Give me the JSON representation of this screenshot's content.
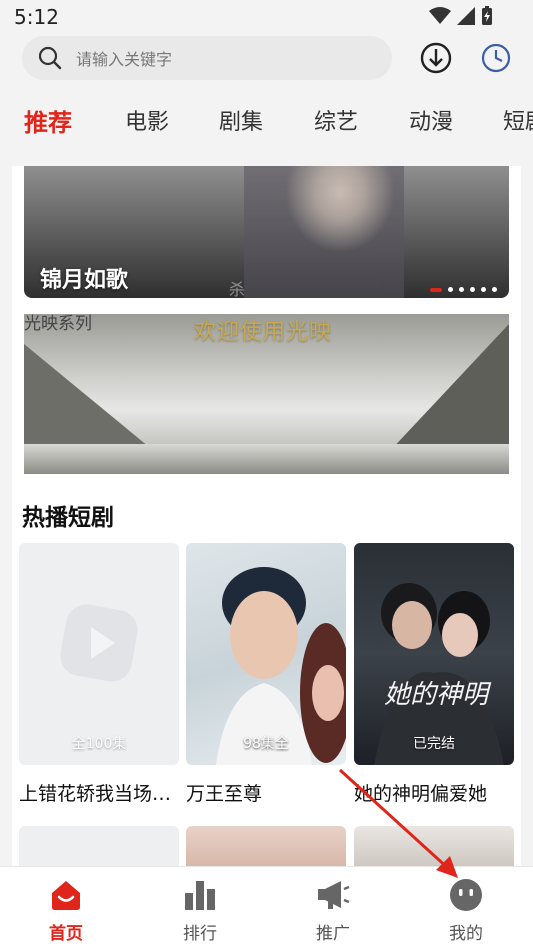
{
  "status": {
    "time": "5:12"
  },
  "search": {
    "placeholder": "请输入关键字"
  },
  "tabs": [
    "推荐",
    "电影",
    "剧集",
    "综艺",
    "动漫",
    "短剧"
  ],
  "banner": {
    "title": "锦月如歌",
    "slide_count": 6,
    "active_slide": 1,
    "watermark": "杀"
  },
  "promo": {
    "series_label": "光映系列",
    "headline": "欢迎使用光映"
  },
  "hot_section": {
    "title": "热播短剧",
    "items": [
      {
        "name": "上错花轿我当场…",
        "badge": "全100集"
      },
      {
        "name": "万王至尊",
        "badge": "98集全"
      },
      {
        "name": "她的神明偏爱她",
        "badge": "已完结"
      }
    ]
  },
  "bottom_nav": [
    {
      "label": "首页",
      "icon": "home-icon",
      "active": true
    },
    {
      "label": "排行",
      "icon": "bar-chart-icon",
      "active": false
    },
    {
      "label": "推广",
      "icon": "megaphone-icon",
      "active": false
    },
    {
      "label": "我的",
      "icon": "profile-face-icon",
      "active": false
    }
  ],
  "colors": {
    "accent": "#e0251b",
    "title_gold": "#c9a94a"
  }
}
